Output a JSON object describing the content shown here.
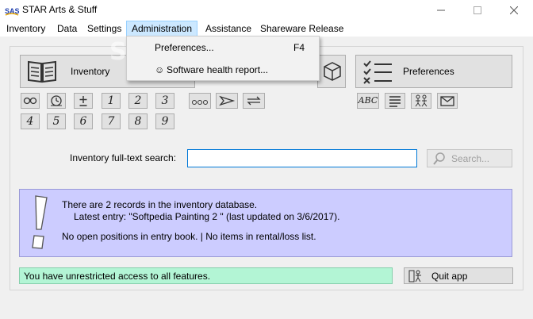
{
  "window": {
    "title": "STAR Arts & Stuff",
    "app_icon": "star-app-icon",
    "minimize_icon": "minimize-icon",
    "maximize_icon": "maximize-icon",
    "close_icon": "close-icon"
  },
  "menubar": {
    "items": [
      "Inventory",
      "Data",
      "Settings",
      "Administration",
      "Assistance",
      "Shareware Release"
    ],
    "active": "Administration"
  },
  "dropdown": {
    "items": [
      {
        "label": "Preferences...",
        "shortcut": "F4",
        "icon": ""
      },
      {
        "label": "Software health report...",
        "shortcut": "",
        "icon": "☺"
      }
    ]
  },
  "watermark": "SOFTPEDIA®",
  "sections": {
    "inventory": {
      "label": "Inventory",
      "icon": "book-icon"
    },
    "middle": {
      "label": "",
      "icon": "cube-icon"
    },
    "preferences": {
      "label": "Preferences",
      "icon": "checklist-icon"
    }
  },
  "small_buttons": {
    "inventory_row1": [
      "glasses-icon",
      "timer-icon",
      "plus-minus-icon",
      "1",
      "2",
      "3"
    ],
    "inventory_row2": [
      "4",
      "5",
      "6",
      "7",
      "8",
      "9"
    ],
    "middle_row": [
      "more-icon",
      "send-icon",
      "exchange-icon"
    ],
    "preferences_row": [
      "spelling-icon",
      "text-align-icon",
      "people-icon",
      "mail-icon"
    ]
  },
  "search": {
    "label": "Inventory full-text search:",
    "value": "",
    "button_label": "Search...",
    "button_icon": "magnifier-icon"
  },
  "info": {
    "icon": "exclamation-icon",
    "line1": "There are 2 records in the inventory database.",
    "line2": "Latest entry: \"Softpedia Painting 2 \" (last updated on 3/6/2017).",
    "line3": "No open positions in entry book. | No items in rental/loss list."
  },
  "status": {
    "text": "You have unrestricted access to all features."
  },
  "quit": {
    "label": "Quit app",
    "icon": "exit-icon"
  },
  "colors": {
    "info_panel": "#ccccff",
    "status_box": "#b3f5d5",
    "menu_highlight": "#cce8ff",
    "input_focus": "#0078d7"
  }
}
